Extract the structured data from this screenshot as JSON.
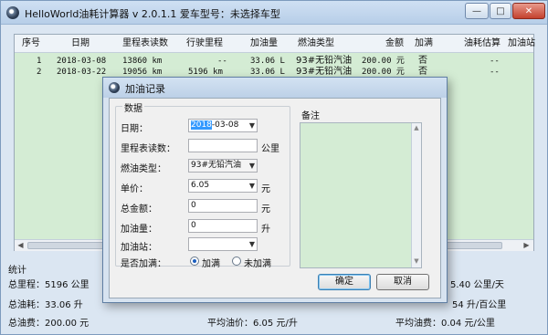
{
  "window": {
    "title": "HelloWorld油耗计算器 v 2.0.1.1   爱车型号：未选择车型",
    "buttons": {
      "minimize": "—",
      "maximize": "□",
      "close": "✕"
    }
  },
  "table": {
    "headers": [
      "序号",
      "日期",
      "里程表读数",
      "行驶里程",
      "加油量",
      "燃油类型",
      "金额",
      "加满",
      "油耗估算",
      "加油站"
    ],
    "rows": [
      [
        "1",
        "2018-03-08",
        "13860 km",
        "--",
        "33.06 L",
        "93#无铅汽油",
        "200.00 元",
        "否",
        "--",
        ""
      ],
      [
        "2",
        "2018-03-22",
        "19056 km",
        "5196 km",
        "33.06 L",
        "93#无铅汽油",
        "200.00 元",
        "否",
        "--",
        ""
      ]
    ]
  },
  "stats": {
    "title": "统计",
    "total_mileage": "总里程：5196 公里",
    "total_fuel": "总油耗：33.06 升",
    "total_cost": "总油费：200.00 元",
    "avg_price": "平均油价：6.05 元/升",
    "per_day": "5.40 公里/天",
    "per_100km": "54 升/百公里",
    "avg_cost_per_km": "平均油费：0.04 元/公里"
  },
  "dialog": {
    "title": "加油记录",
    "group_data": "数据",
    "group_notes": "备注",
    "labels": {
      "date": "日期：",
      "odometer": "里程表读数：",
      "fuel_type": "燃油类型：",
      "unit_price": "单价：",
      "total_amount": "总金额：",
      "fuel_amount": "加油量：",
      "station": "加油站：",
      "full": "是否加满："
    },
    "values": {
      "date_year": "2018",
      "date_rest": "-03-08",
      "odometer": "",
      "fuel_type": "93#无铅汽油",
      "unit_price": "6.05",
      "total_amount": "0",
      "fuel_amount": "0",
      "station": ""
    },
    "units": {
      "odometer": "公里",
      "unit_price": "元",
      "total_amount": "元",
      "fuel_amount": "升"
    },
    "radio": {
      "full": "加满",
      "not_full": "未加满"
    },
    "buttons": {
      "ok": "确定",
      "cancel": "取消"
    }
  }
}
